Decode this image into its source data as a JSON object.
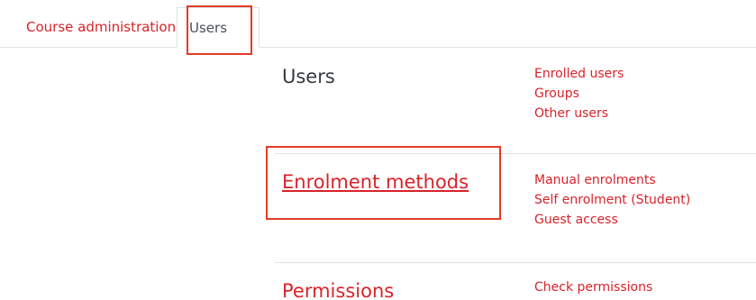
{
  "tabs": {
    "course_admin_label": "Course administration",
    "users_label": "Users"
  },
  "sections": {
    "users": {
      "heading": "Users",
      "links": [
        "Enrolled users",
        "Groups",
        "Other users"
      ]
    },
    "enrolment": {
      "heading": "Enrolment methods",
      "links": [
        "Manual enrolments",
        "Self enrolment (Student)",
        "Guest access"
      ]
    },
    "permissions": {
      "heading": "Permissions",
      "links": [
        "Check permissions"
      ]
    }
  },
  "colors": {
    "link": "#d8232a",
    "highlight": "#e53b24",
    "text": "#343a40"
  }
}
